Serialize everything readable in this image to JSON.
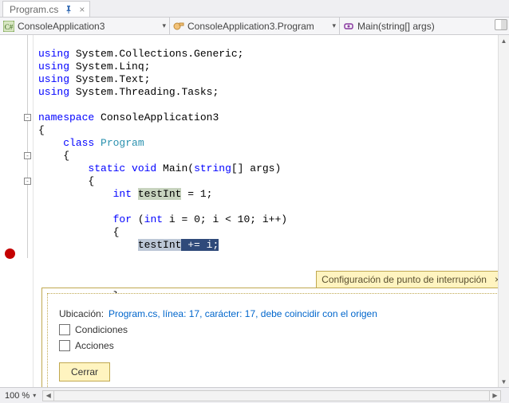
{
  "tab": {
    "title": "Program.cs"
  },
  "nav": {
    "project": "ConsoleApplication3",
    "class": "ConsoleApplication3.Program",
    "method": "Main(string[] args)"
  },
  "code": {
    "l1": "using",
    "l1b": " System.Collections.Generic;",
    "l2": "using",
    "l2b": " System.Linq;",
    "l3": "using",
    "l3b": " System.Text;",
    "l4": "using",
    "l4b": " System.Threading.Tasks;",
    "ns": "namespace",
    "nsb": " ConsoleApplication3",
    "ob": "{",
    "cls": "class ",
    "clsn": "Program",
    "ob2": "    {",
    "stat": "static ",
    "void": "void",
    "main": " Main(",
    "strarr": "string",
    "mainb": "[] args)",
    "ob3": "        {",
    "int": "int ",
    "ti": "testInt",
    "ti2": " = 1;",
    "for": "for ",
    "forb": "(",
    "int2": "int",
    "forb2": " i = 0; i < 10; i++)",
    "ob4": "            {",
    "bp_var": "testInt",
    "bp_op": " += i;",
    "cb": "            }"
  },
  "popup": {
    "title": "Configuración de punto de interrupción",
    "loc_label": "Ubicación: ",
    "loc_link": "Program.cs, línea: 17, carácter: 17, debe coincidir con el origen",
    "conditions": "Condiciones",
    "actions": "Acciones",
    "close_btn": "Cerrar"
  },
  "status": {
    "zoom": "100 %"
  }
}
